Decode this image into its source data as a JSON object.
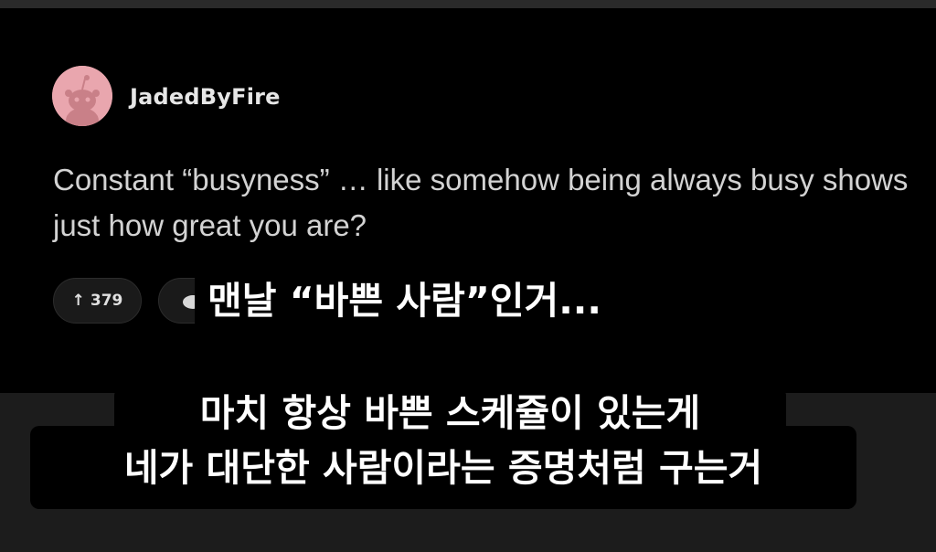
{
  "post": {
    "username": "JadedByFire",
    "avatar_icon": "reddit-snoo-icon",
    "body": "Constant “busyness” … like somehow being always busy shows just how great you are?",
    "vote_count": "379",
    "comment_icon": "comment-bubble-icon"
  },
  "captions": {
    "line1": "맨날 “바쁜 사람”인거...",
    "line2": "마치  항상 바쁜 스케쥴이 있는게",
    "line3": "네가 대단한 사람이라는 증명처럼 구는거"
  },
  "colors": {
    "post_bg": "#000000",
    "page_bg": "#1c1c1c",
    "avatar_bg": "#e9a6ae"
  }
}
